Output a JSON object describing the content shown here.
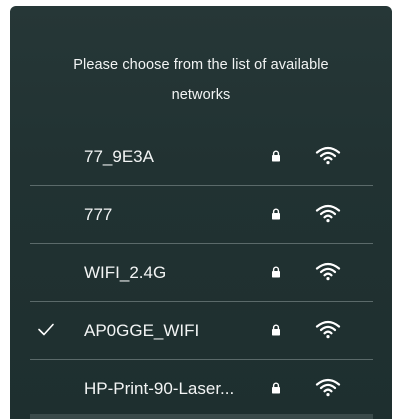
{
  "dialog": {
    "prompt_line1": "Please choose from the list of available",
    "prompt_line2": "networks"
  },
  "networks": [
    {
      "ssid": "77_9E3A",
      "secured": true,
      "signal": "full",
      "selected": false
    },
    {
      "ssid": "777",
      "secured": true,
      "signal": "full",
      "selected": false
    },
    {
      "ssid": "WIFI_2.4G",
      "secured": true,
      "signal": "full",
      "selected": false
    },
    {
      "ssid": "AP0GGE_WIFI",
      "secured": true,
      "signal": "full",
      "selected": true
    },
    {
      "ssid": "HP-Print-90-Laser...",
      "secured": true,
      "signal": "full",
      "selected": false
    }
  ],
  "icons": {
    "lock": "lock-icon",
    "wifi": "wifi-icon",
    "check": "checkmark-icon"
  },
  "colors": {
    "panel_background": "#233434",
    "text": "#f3f5f5",
    "divider": "#5b6a6a"
  }
}
